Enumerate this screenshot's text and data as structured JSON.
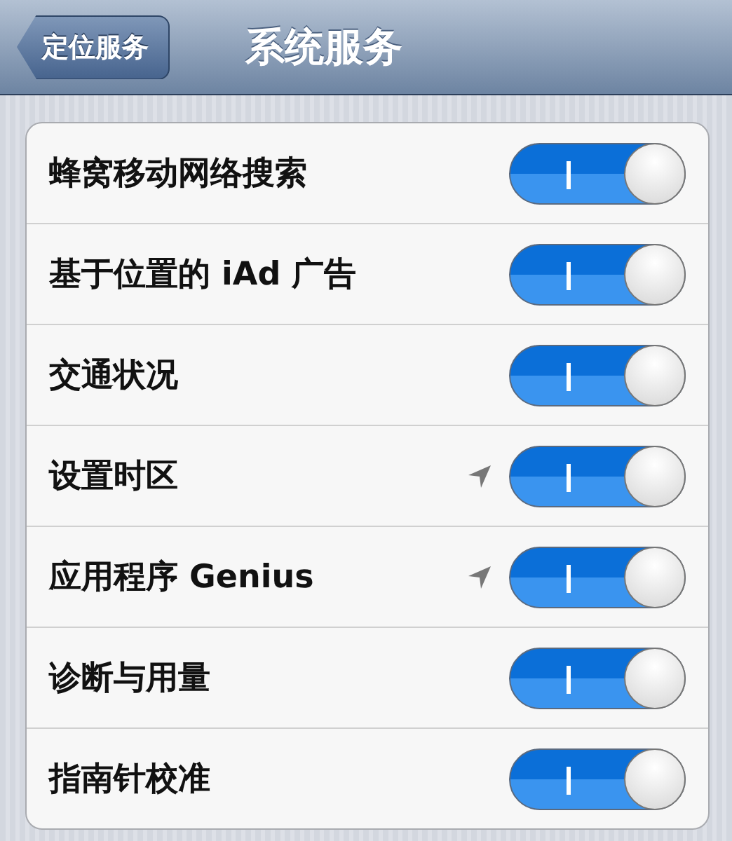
{
  "nav_bar": {
    "back_button": "定位服务",
    "title": "系统服务"
  },
  "rows": [
    {
      "label": "蜂窝移动网络搜索",
      "location_arrow": false,
      "on": true
    },
    {
      "label": "基于位置的 iAd 广告",
      "location_arrow": false,
      "on": true
    },
    {
      "label": "交通状况",
      "location_arrow": false,
      "on": true
    },
    {
      "label": "设置时区",
      "location_arrow": true,
      "on": true
    },
    {
      "label": "应用程序 Genius",
      "location_arrow": true,
      "on": true
    },
    {
      "label": "诊断与用量",
      "location_arrow": false,
      "on": true
    },
    {
      "label": "指南针校准",
      "location_arrow": false,
      "on": true
    }
  ]
}
